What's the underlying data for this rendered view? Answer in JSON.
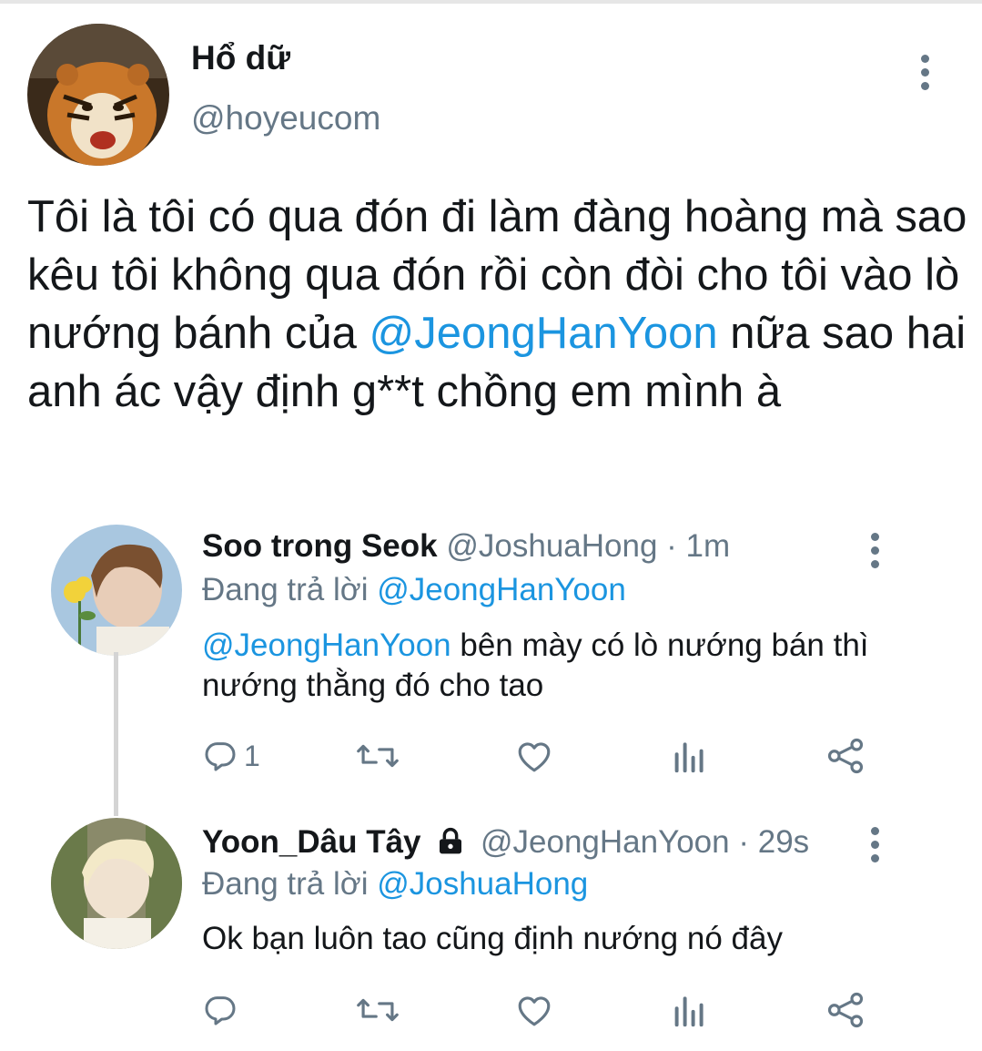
{
  "tweet": {
    "author_name": "Hổ dữ",
    "author_handle": "@hoyeucom",
    "text_before": "Tôi là tôi có qua đón đi làm đàng hoàng mà sao kêu tôi không qua đón rồi còn đòi cho tôi vào lò nướng bánh của ",
    "mention": "@JeongHanYoon",
    "text_after": " nữa sao hai anh ác vậy định g**t chồng em mình à"
  },
  "replies": [
    {
      "name": "Soo trong Seok",
      "handle": "@JoshuaHong",
      "time": "· 1m",
      "replying_label": "Đang trả lời",
      "replying_to": "@JeongHanYoon",
      "mention": "@JeongHanYoon",
      "text": " bên mày có lò nướng bán thì nướng thằng đó cho tao",
      "reply_count": "1"
    },
    {
      "name": "Yoon_Dâu Tây",
      "handle": "@JeongHanYoon",
      "time": "· 29s",
      "replying_label": "Đang trả lời",
      "replying_to": "@JoshuaHong",
      "text": "Ok bạn luôn tao cũng định nướng nó đây",
      "reply_count": ""
    }
  ],
  "icons": {
    "reply": "reply-icon",
    "retweet": "retweet-icon",
    "like": "heart-icon",
    "analytics": "analytics-icon",
    "share": "share-icon",
    "more": "more-vertical-icon",
    "lock": "lock-icon"
  },
  "colors": {
    "link": "#1b95e0",
    "muted": "#657786",
    "text": "#14171a"
  }
}
